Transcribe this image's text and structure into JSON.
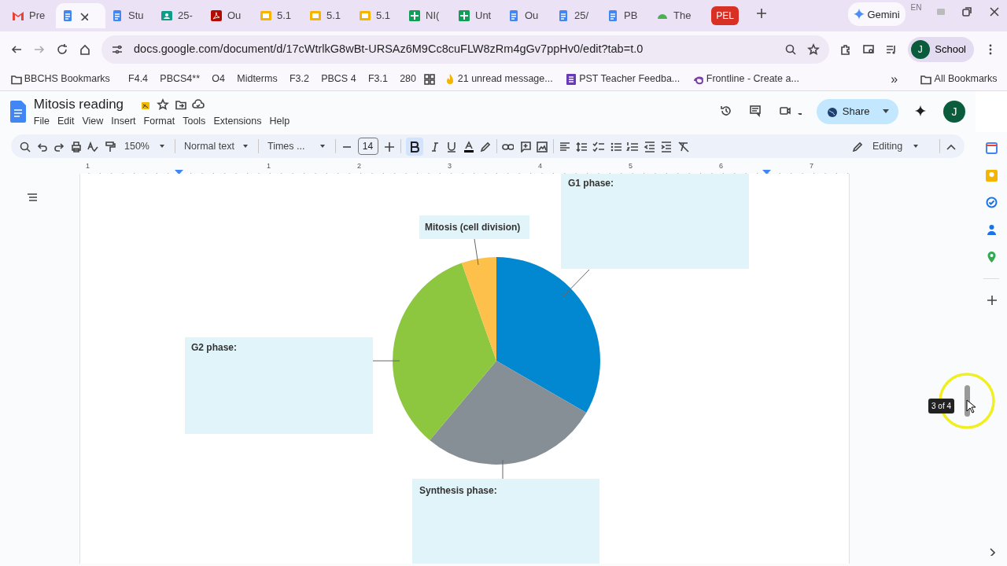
{
  "browser": {
    "tabs": [
      {
        "kind": "mail",
        "label": "Pre",
        "selected": false
      },
      {
        "kind": "doc",
        "selected": true
      },
      {
        "kind": "doc",
        "label": "Stu",
        "selected": false
      },
      {
        "kind": "classroom",
        "label": "25-",
        "selected": false
      },
      {
        "kind": "pdf",
        "label": "Ou",
        "selected": false
      },
      {
        "kind": "slides",
        "label": "5.1",
        "selected": false
      },
      {
        "kind": "slides",
        "label": "5.1",
        "selected": false
      },
      {
        "kind": "slides",
        "label": "5.1",
        "selected": false
      },
      {
        "kind": "sheet",
        "label": "NI(",
        "selected": false
      },
      {
        "kind": "sheet",
        "label": "Unt",
        "selected": false
      },
      {
        "kind": "doc",
        "label": "Ou",
        "selected": false
      },
      {
        "kind": "doc",
        "label": "25/",
        "selected": false
      },
      {
        "kind": "doc",
        "label": "PB",
        "selected": false
      },
      {
        "kind": "cloud",
        "label": "The",
        "selected": false
      },
      {
        "kind": "badge",
        "label": "PEL",
        "selected": false
      }
    ],
    "gemini": "Gemini",
    "lang": "EN",
    "url": "docs.google.com/document/d/17cWtrlkG8wBt-URSAz6M9Cc8cuFLW8zRm4gGv7ppHv0/edit?tab=t.0",
    "profile": {
      "initial": "J",
      "label": "School"
    },
    "bookmarks": [
      {
        "kind": "folder",
        "label": "BBCHS Bookmarks"
      },
      {
        "kind": "text",
        "label": "F4.4"
      },
      {
        "kind": "text",
        "label": "PBCS4**"
      },
      {
        "kind": "text",
        "label": "O4"
      },
      {
        "kind": "text",
        "label": "Midterms"
      },
      {
        "kind": "text",
        "label": "F3.2"
      },
      {
        "kind": "text",
        "label": "PBCS 4"
      },
      {
        "kind": "text",
        "label": "F3.1"
      },
      {
        "kind": "text",
        "label": "280"
      },
      {
        "kind": "apps"
      },
      {
        "kind": "site",
        "label": "21 unread message..."
      },
      {
        "kind": "site",
        "label": "PST Teacher Feedba..."
      },
      {
        "kind": "site",
        "label": "Frontline - Create a..."
      }
    ],
    "more_bookmarks": "»",
    "all_bookmarks": "All Bookmarks"
  },
  "document": {
    "title": "Mitosis reading",
    "menu": [
      "File",
      "Edit",
      "View",
      "Insert",
      "Format",
      "Tools",
      "Extensions",
      "Help"
    ],
    "share": "Share",
    "avatar": "J",
    "toolbar": {
      "zoom": "150%",
      "style": "Normal text",
      "font": "Times ...",
      "font_size": "14",
      "bold": true,
      "mode": "Editing"
    },
    "ruler": [
      "1",
      "1",
      "2",
      "3",
      "4",
      "5",
      "6",
      "7"
    ],
    "labels": [
      {
        "kind": "g1",
        "text": "G1 phase:"
      },
      {
        "kind": "mitosis",
        "text": "Mitosis (cell division)"
      },
      {
        "kind": "g2",
        "text": "G2 phase:"
      },
      {
        "kind": "synthesis",
        "text": "Synthesis phase:"
      }
    ],
    "page_tooltip": "3 of 4"
  }
}
